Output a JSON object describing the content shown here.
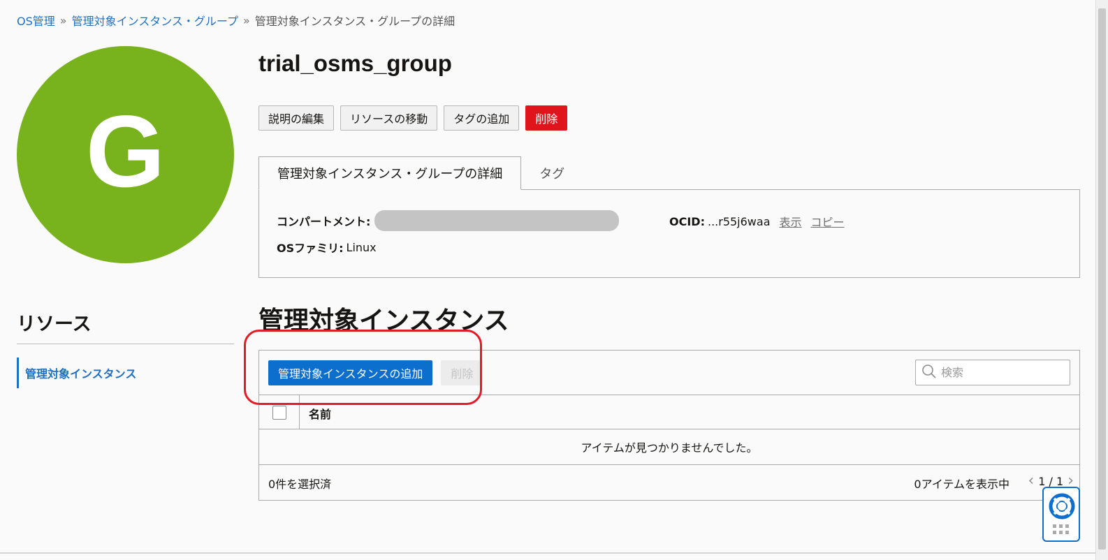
{
  "breadcrumb": {
    "items": [
      "OS管理",
      "管理対象インスタンス・グループ"
    ],
    "separator": "»",
    "current": "管理対象インスタンス・グループの詳細"
  },
  "avatar": {
    "letter": "G",
    "color": "#78b21d"
  },
  "title": "trial_osms_group",
  "actions": {
    "edit_description": "説明の編集",
    "move_resource": "リソースの移動",
    "add_tags": "タグの追加",
    "delete": "削除"
  },
  "tabs": {
    "details": "管理対象インスタンス・グループの詳細",
    "tags": "タグ"
  },
  "details": {
    "compartment_label": "コンパートメント:",
    "os_family_label": "OSファミリ:",
    "os_family_value": "Linux",
    "ocid_label": "OCID:",
    "ocid_value": "...r55j6waa",
    "show_link": "表示",
    "copy_link": "コピー"
  },
  "resources": {
    "title": "リソース",
    "items": [
      "管理対象インスタンス"
    ]
  },
  "instances": {
    "title": "管理対象インスタンス",
    "add_button": "管理対象インスタンスの追加",
    "delete_button": "削除",
    "search_placeholder": "検索",
    "column_name": "名前",
    "empty_message": "アイテムが見つかりませんでした。",
    "selected_count": "0件を選択済",
    "showing_count": "0アイテムを表示中",
    "page": "1 / 1"
  },
  "colors": {
    "accent": "#0c6ecd",
    "link": "#1f6fc2",
    "danger": "#e0151b",
    "highlight": "#e21b26"
  }
}
